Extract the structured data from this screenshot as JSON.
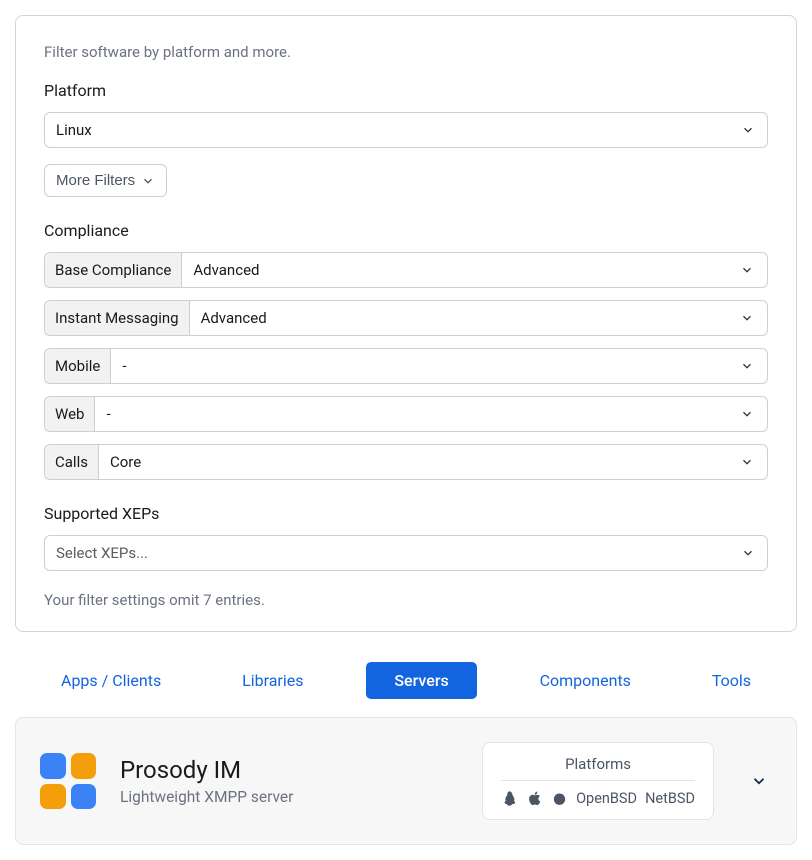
{
  "filter": {
    "intro": "Filter software by platform and more.",
    "platform_label": "Platform",
    "platform_value": "Linux",
    "more_filters_label": "More Filters",
    "compliance_label": "Compliance",
    "compliance_rows": [
      {
        "label": "Base Compliance",
        "value": "Advanced"
      },
      {
        "label": "Instant Messaging",
        "value": "Advanced"
      },
      {
        "label": "Mobile",
        "value": "-"
      },
      {
        "label": "Web",
        "value": "-"
      },
      {
        "label": "Calls",
        "value": "Core"
      }
    ],
    "xeps_label": "Supported XEPs",
    "xeps_placeholder": "Select XEPs...",
    "omit_text": "Your filter settings omit 7 entries."
  },
  "tabs": {
    "items": [
      "Apps / Clients",
      "Libraries",
      "Servers",
      "Components",
      "Tools"
    ],
    "active_index": 2
  },
  "result": {
    "title": "Prosody IM",
    "subtitle": "Lightweight XMPP server",
    "platforms_heading": "Platforms",
    "platforms_text": [
      "OpenBSD",
      "NetBSD"
    ],
    "icon_colors": {
      "blue": "#3b82f6",
      "orange": "#f59e0b"
    }
  }
}
